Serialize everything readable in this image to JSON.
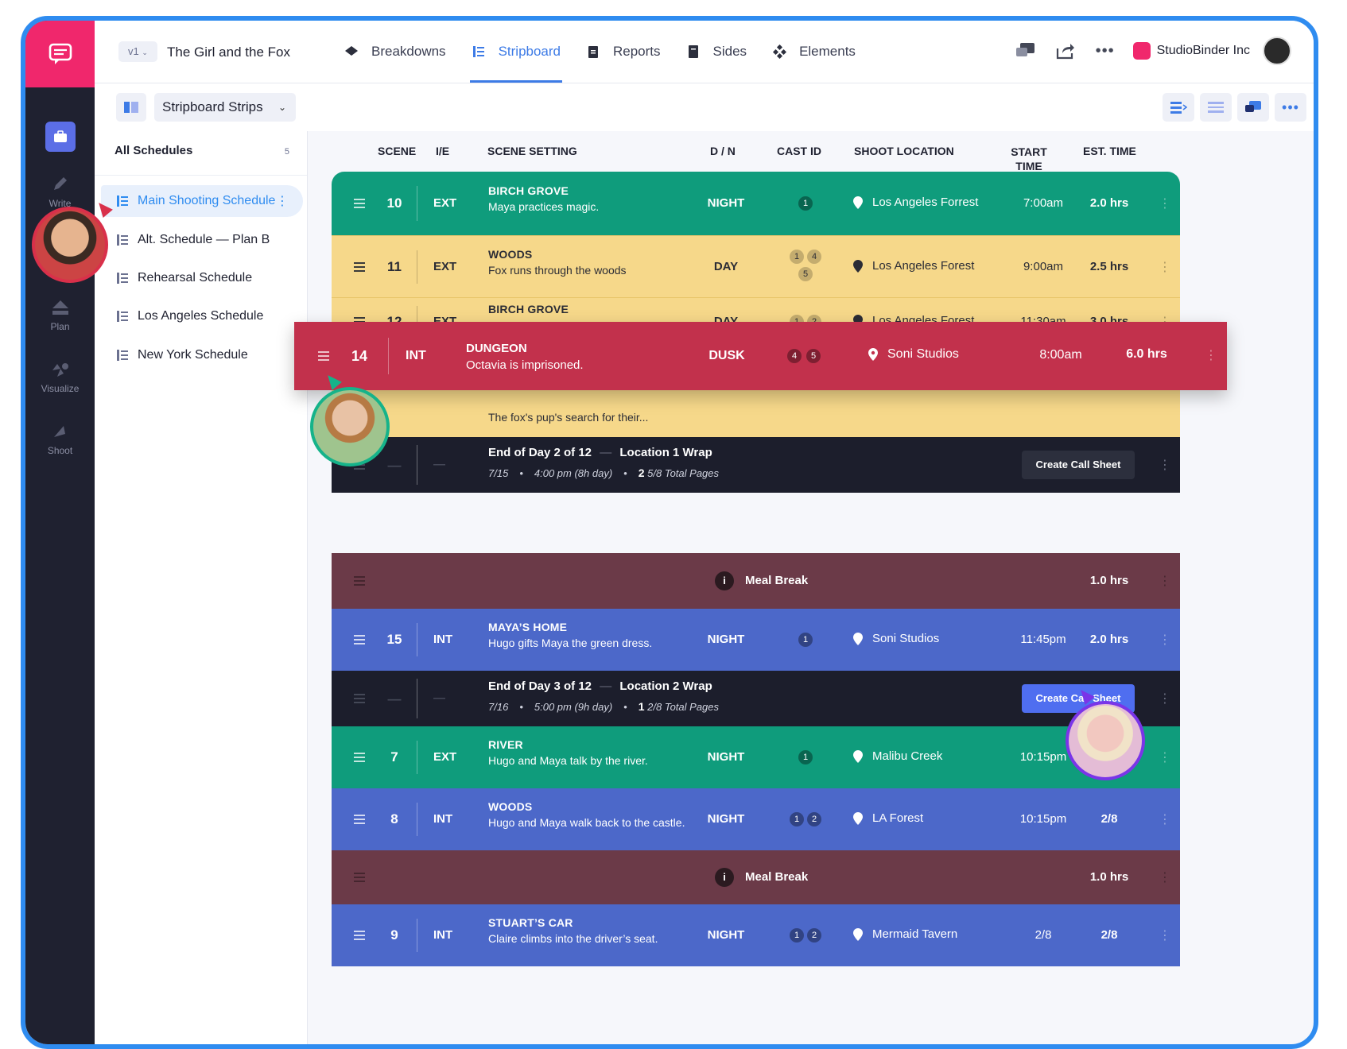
{
  "app": {
    "version": "v1",
    "project_title": "The Girl and the Fox",
    "company": "StudioBinder Inc"
  },
  "tabs": [
    {
      "label": "Breakdowns",
      "icon": "layers-icon"
    },
    {
      "label": "Stripboard",
      "icon": "list-icon",
      "active": true
    },
    {
      "label": "Reports",
      "icon": "clipboard-icon"
    },
    {
      "label": "Sides",
      "icon": "script-icon"
    },
    {
      "label": "Elements",
      "icon": "diamond-grid-icon"
    }
  ],
  "rail": {
    "write": "Write",
    "plan": "Plan",
    "visualize": "Visualize",
    "shoot": "Shoot"
  },
  "subbar": {
    "view_select": "Stripboard Strips"
  },
  "schedules": {
    "header": "All Schedules",
    "count": "5",
    "items": [
      {
        "label": "Main Shooting Schedule",
        "active": true
      },
      {
        "label": "Alt. Schedule — Plan B"
      },
      {
        "label": "Rehearsal Schedule"
      },
      {
        "label": "Los Angeles Schedule"
      },
      {
        "label": "New York Schedule"
      }
    ]
  },
  "columns": {
    "scene": "SCENE",
    "ie": "I/E",
    "setting": "SCENE SETTING",
    "dn": "D / N",
    "cast": "CAST ID",
    "location": "SHOOT LOCATION",
    "start": "START TIME",
    "est": "EST. TIME"
  },
  "strips": [
    {
      "scene": "10",
      "ie": "EXT",
      "set1": "BIRCH GROVE",
      "set2": "Maya practices magic.",
      "dn": "NIGHT",
      "cast": [
        "1"
      ],
      "location": "Los Angeles Forrest",
      "start": "7:00am",
      "est": "2.0 hrs"
    },
    {
      "scene": "11",
      "ie": "EXT",
      "set1": "WOODS",
      "set2": "Fox runs through the woods",
      "dn": "DAY",
      "cast": [
        "1",
        "4",
        "5"
      ],
      "location": "Los Angeles Forest",
      "start": "9:00am",
      "est": "2.5 hrs"
    },
    {
      "scene": "12",
      "ie": "EXT",
      "set1": "BIRCH GROVE",
      "set2": "",
      "dn": "DAY",
      "cast": [
        "1",
        "2"
      ],
      "location": "Los Angeles Forest",
      "start": "11:30am",
      "est": "3.0 hrs"
    },
    {
      "set2": "The fox's pup's search for their..."
    },
    {
      "eod": "End of Day 2 of 12",
      "wrap": "Location 1 Wrap",
      "date": "7/15",
      "time": "4:00 pm (8h day)",
      "pages_big": "2",
      "pages_small": "5/8 Total Pages",
      "button": "Create Call Sheet",
      "dash": "—"
    },
    {
      "meal": "Meal Break",
      "info": "i",
      "est": "1.0 hrs"
    },
    {
      "scene": "15",
      "ie": "INT",
      "set1": "MAYA’S HOME",
      "set2": "Hugo gifts Maya the green dress.",
      "dn": "NIGHT",
      "cast": [
        "1"
      ],
      "location": "Soni Studios",
      "start": "11:45pm",
      "est": "2.0 hrs"
    },
    {
      "eod": "End of Day 3 of 12",
      "wrap": "Location 2 Wrap",
      "date": "7/16",
      "time": "5:00 pm (9h day)",
      "pages_big": "1",
      "pages_small": "2/8 Total Pages",
      "button": "Create Call Sheet",
      "dash": "—"
    },
    {
      "scene": "7",
      "ie": "EXT",
      "set1": "RIVER",
      "set2": "Hugo and Maya talk by the river.",
      "dn": "NIGHT",
      "cast": [
        "1"
      ],
      "location": "Malibu Creek",
      "start": "10:15pm",
      "est": ""
    },
    {
      "scene": "8",
      "ie": "INT",
      "set1": "WOODS",
      "set2": "Hugo and Maya walk back to the castle.",
      "dn": "NIGHT",
      "cast": [
        "1",
        "2"
      ],
      "location": "LA Forest",
      "start": "10:15pm",
      "est": "2/8"
    },
    {
      "meal": "Meal Break",
      "info": "i",
      "est": "1.0 hrs"
    },
    {
      "scene": "9",
      "ie": "INT",
      "set1": "STUART’S CAR",
      "set2": "Claire climbs into the driver’s seat.",
      "dn": "NIGHT",
      "cast": [
        "1",
        "2"
      ],
      "location": "Mermaid Tavern",
      "start": "2/8",
      "est": "2/8"
    }
  ],
  "drag": {
    "scene": "14",
    "ie": "INT",
    "set1": "DUNGEON",
    "set2": "Octavia is imprisoned.",
    "dn": "DUSK",
    "cast": [
      "4",
      "5"
    ],
    "location": "Soni Studios",
    "start": "8:00am",
    "est": "6.0 hrs"
  },
  "colors": {
    "green": "#0f9c7c",
    "yellow": "#f6d88a",
    "red": "#c2314c",
    "blue": "#4c68c9",
    "dark": "#1c1e2c",
    "maroon": "#6b3a48",
    "pink": "#f0276c",
    "accent": "#3d7be6"
  }
}
